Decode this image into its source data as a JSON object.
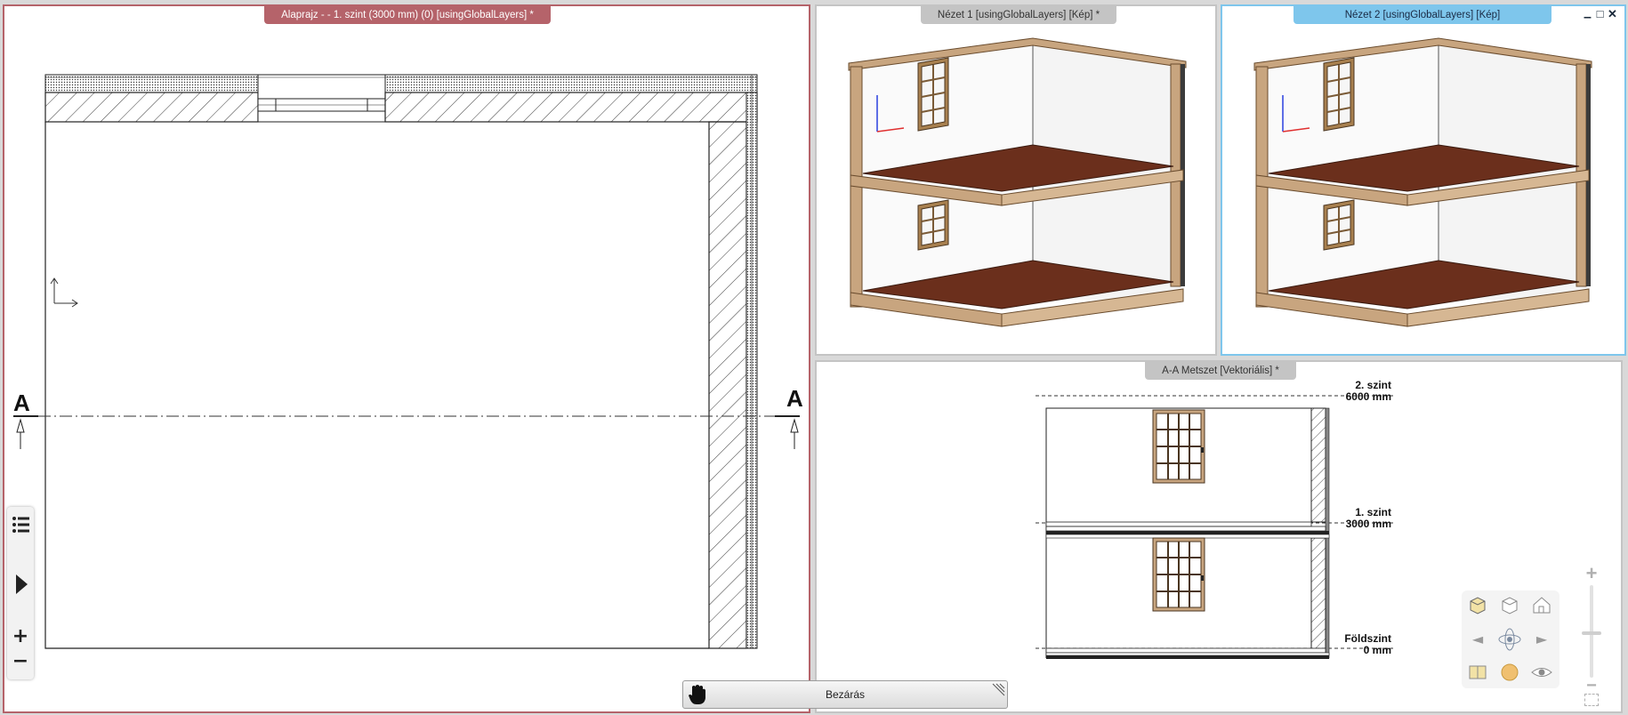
{
  "windows": {
    "floor_plan": {
      "title": "Alaprajz -  - 1. szint (3000 mm) (0) [usingGlobalLayers] *"
    },
    "view1": {
      "title": "Nézet 1 [usingGlobalLayers] [Kép] *"
    },
    "view2": {
      "title": "Nézet 2 [usingGlobalLayers] [Kép]"
    },
    "section": {
      "title": "A-A Metszet [Vektoriális] *"
    }
  },
  "section_markers": {
    "left": "A",
    "right": "A"
  },
  "levels": [
    {
      "name": "2. szint",
      "elevation": "6000 mm"
    },
    {
      "name": "1. szint",
      "elevation": "3000 mm"
    },
    {
      "name": "Földszint",
      "elevation": "0 mm"
    }
  ],
  "window_controls": {
    "minimize": "▁",
    "maximize": "□",
    "close": "✕"
  },
  "left_toolbar": {
    "list_icon": "list-icon",
    "expand_icon": "play-icon",
    "zoom_in": "+",
    "zoom_out": "−"
  },
  "close_bar": {
    "label": "Bezárás",
    "icon": "hand-icon"
  },
  "navigation": {
    "arrow_left": "◄",
    "arrow_right": "►",
    "zoom_plus": "+",
    "zoom_minus": "−"
  },
  "colors": {
    "active_tab": "#b5636a",
    "selected_view_tab": "#7ec6ec",
    "inactive_tab": "#c4c4c4",
    "floor_wood": "#6b2f1c",
    "frame_wood": "#c8a57f"
  }
}
